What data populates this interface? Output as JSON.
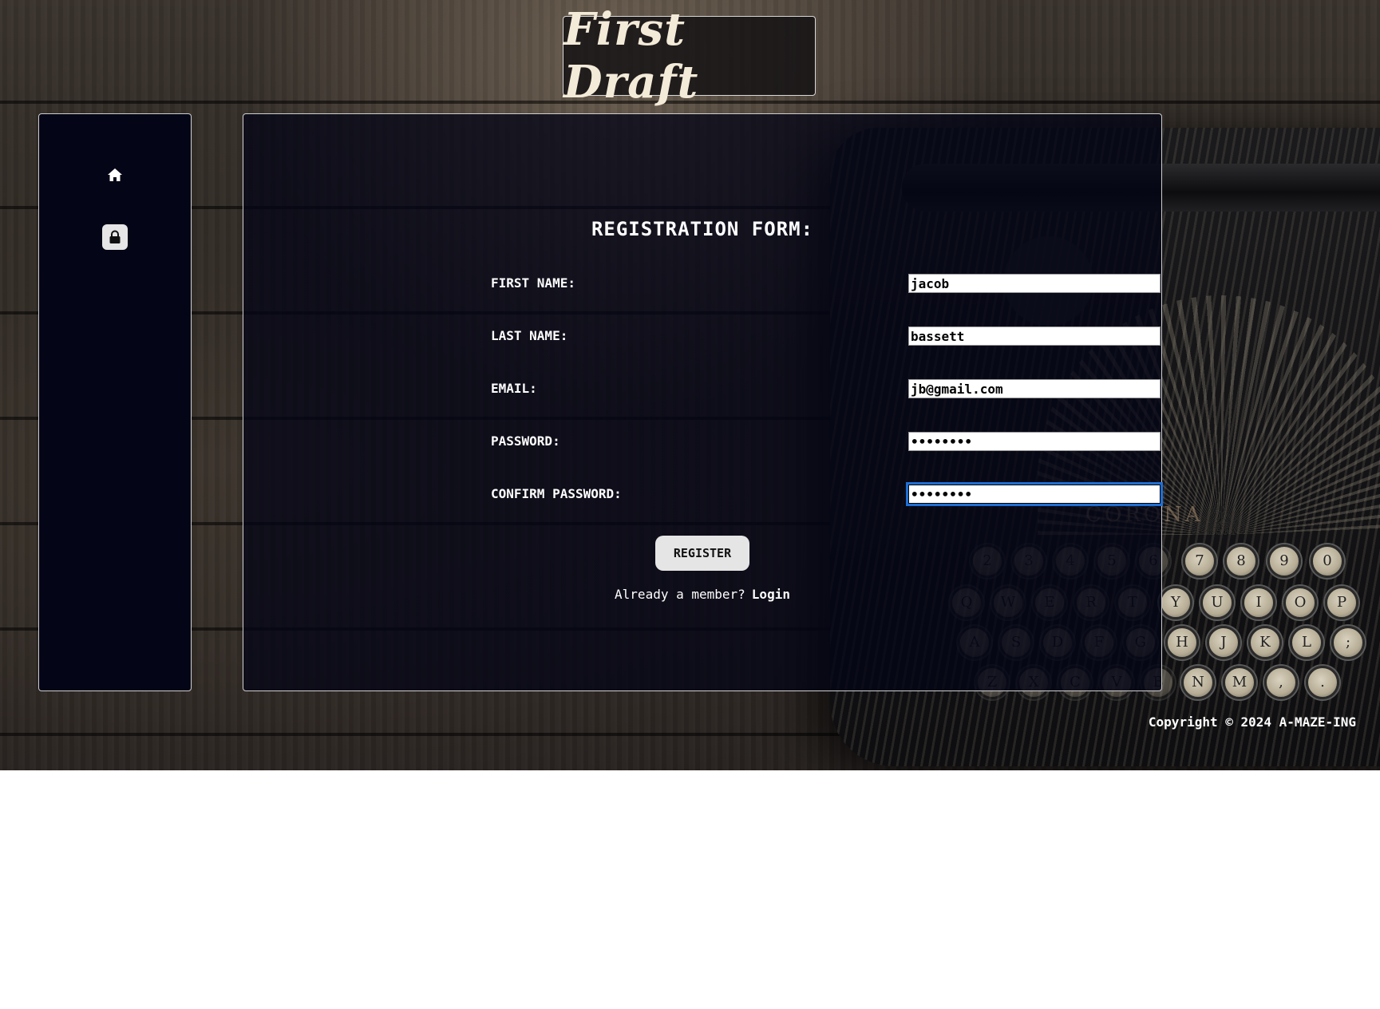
{
  "header": {
    "title": "First Draft"
  },
  "sidebar": {
    "items": [
      {
        "icon": "home-icon",
        "label": "Home"
      },
      {
        "icon": "lock-icon",
        "label": "Register",
        "active": true
      }
    ]
  },
  "form": {
    "title": "REGISTRATION FORM:",
    "fields": [
      {
        "label": "FIRST NAME:",
        "value": "jacob",
        "type": "text"
      },
      {
        "label": "LAST NAME:",
        "value": "bassett",
        "type": "text"
      },
      {
        "label": "EMAIL:",
        "value": "jb@gmail.com",
        "type": "email"
      },
      {
        "label": "PASSWORD:",
        "value": "••••••••",
        "type": "password"
      },
      {
        "label": "CONFIRM PASSWORD:",
        "value": "••••••••",
        "type": "password",
        "focused": true
      }
    ],
    "submit_label": "REGISTER",
    "member_prompt": "Already a member?",
    "login_link": "Login"
  },
  "background": {
    "typewriter_brand": "CORONA",
    "keys_row1": [
      "2",
      "3",
      "4",
      "5",
      "6",
      "7",
      "8",
      "9",
      "0"
    ],
    "keys_row2": [
      "Q",
      "W",
      "E",
      "R",
      "T",
      "Y",
      "U",
      "I",
      "O",
      "P"
    ],
    "keys_row3": [
      "A",
      "S",
      "D",
      "F",
      "G",
      "H",
      "J",
      "K",
      "L",
      ";"
    ],
    "keys_row4": [
      "Z",
      "X",
      "C",
      "V",
      "B",
      "N",
      "M",
      ",",
      "."
    ]
  },
  "footer": {
    "copyright": "Copyright © 2024 A-MAZE-ING"
  },
  "colors": {
    "panel_bg": "#040516",
    "focus_outline": "#1f6fd6",
    "button_bg": "#e5e5e5"
  }
}
